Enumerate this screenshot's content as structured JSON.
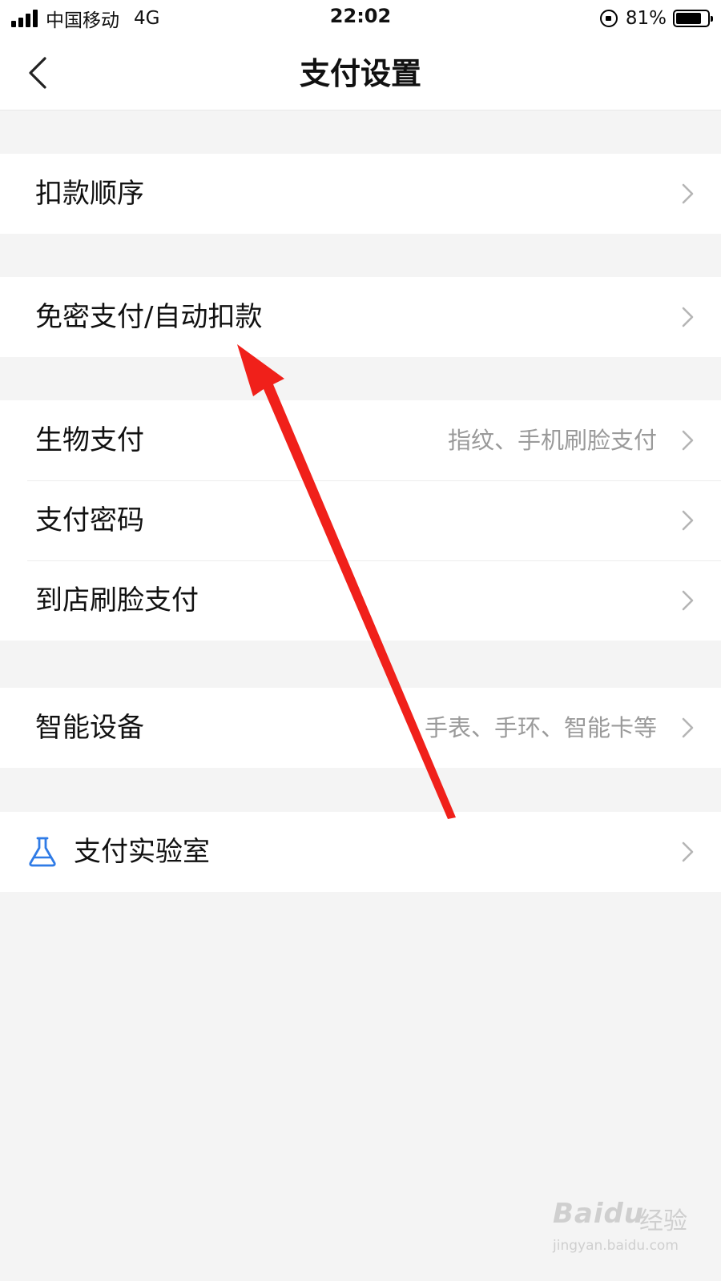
{
  "status_bar": {
    "carrier": "中国移动",
    "network": "4G",
    "time": "22:02",
    "battery": "81%",
    "battery_level": 0.81
  },
  "header": {
    "title": "支付设置",
    "back_icon": "chevron-left-icon"
  },
  "groups": [
    {
      "items": [
        {
          "label": "扣款顺序",
          "sub": ""
        }
      ]
    },
    {
      "items": [
        {
          "label": "免密支付/自动扣款",
          "sub": ""
        }
      ]
    },
    {
      "items": [
        {
          "label": "生物支付",
          "sub": "指纹、手机刷脸支付"
        },
        {
          "label": "支付密码",
          "sub": ""
        },
        {
          "label": "到店刷脸支付",
          "sub": ""
        }
      ]
    },
    {
      "items": [
        {
          "label": "智能设备",
          "sub": "手表、手环、智能卡等"
        }
      ]
    },
    {
      "items": [
        {
          "label": "支付实验室",
          "sub": "",
          "icon": "flask-icon"
        }
      ]
    }
  ],
  "annotation": {
    "color": "#f0201a",
    "icon": "red-arrow"
  },
  "watermark": {
    "brand": "Baidu",
    "cn": "经验",
    "url": "jingyan.baidu.com"
  },
  "colors": {
    "background": "#f4f4f4",
    "accent_icon": "#2f7be6",
    "subtext": "#9a9a9a"
  }
}
